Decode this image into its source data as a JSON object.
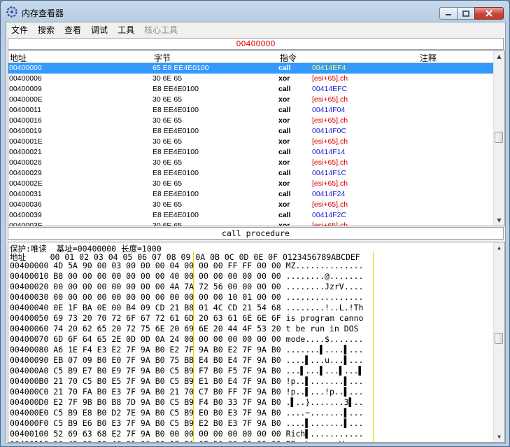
{
  "window": {
    "title": "内存查看器"
  },
  "menu": [
    "文件",
    "搜索",
    "查看",
    "调试",
    "工具",
    "核心工具"
  ],
  "address_bar": "00400000",
  "disasm": {
    "headers": {
      "address": "地址",
      "bytes": "字节",
      "opcode": "指令",
      "comment": "注释"
    },
    "rows": [
      {
        "addr": "00400000",
        "bytes": "65 E8 EE4E0100",
        "op": "call",
        "arg": "00414EF4",
        "kind": "call"
      },
      {
        "addr": "00400006",
        "bytes": "30 6E 65",
        "op": "xor",
        "arg1": "[esi+65]",
        "arg2": ",ch",
        "kind": "xor"
      },
      {
        "addr": "00400009",
        "bytes": "E8 EE4E0100",
        "op": "call",
        "arg": "00414EFC",
        "kind": "call"
      },
      {
        "addr": "0040000E",
        "bytes": "30 6E 65",
        "op": "xor",
        "arg1": "[esi+65]",
        "arg2": ",ch",
        "kind": "xor"
      },
      {
        "addr": "00400011",
        "bytes": "E8 EE4E0100",
        "op": "call",
        "arg": "00414F04",
        "kind": "call"
      },
      {
        "addr": "00400016",
        "bytes": "30 6E 65",
        "op": "xor",
        "arg1": "[esi+65]",
        "arg2": ",ch",
        "kind": "xor"
      },
      {
        "addr": "00400019",
        "bytes": "E8 EE4E0100",
        "op": "call",
        "arg": "00414F0C",
        "kind": "call"
      },
      {
        "addr": "0040001E",
        "bytes": "30 6E 65",
        "op": "xor",
        "arg1": "[esi+65]",
        "arg2": ",ch",
        "kind": "xor"
      },
      {
        "addr": "00400021",
        "bytes": "E8 EE4E0100",
        "op": "call",
        "arg": "00414F14",
        "kind": "call"
      },
      {
        "addr": "00400026",
        "bytes": "30 6E 65",
        "op": "xor",
        "arg1": "[esi+65]",
        "arg2": ",ch",
        "kind": "xor"
      },
      {
        "addr": "00400029",
        "bytes": "E8 EE4E0100",
        "op": "call",
        "arg": "00414F1C",
        "kind": "call"
      },
      {
        "addr": "0040002E",
        "bytes": "30 6E 65",
        "op": "xor",
        "arg1": "[esi+65]",
        "arg2": ",ch",
        "kind": "xor"
      },
      {
        "addr": "00400031",
        "bytes": "E8 EE4E0100",
        "op": "call",
        "arg": "00414F24",
        "kind": "call"
      },
      {
        "addr": "00400036",
        "bytes": "30 6E 65",
        "op": "xor",
        "arg1": "[esi+65]",
        "arg2": ",ch",
        "kind": "xor"
      },
      {
        "addr": "00400039",
        "bytes": "E8 EE4E0100",
        "op": "call",
        "arg": "00414F2C",
        "kind": "call"
      },
      {
        "addr": "0040003E",
        "bytes": "30 6E 65",
        "op": "xor",
        "arg1": "[esi+65]",
        "arg2": ",ch",
        "kind": "xor"
      }
    ]
  },
  "status_line": "call procedure",
  "hex": {
    "info": "保护:唯读  基址=00400000 长度=1000",
    "header": "地址     00 01 02 03 04 05 06 07 08 09 0A 0B 0C 0D 0E 0F 0123456789ABCDEF",
    "rows": [
      "00400000 4D 5A 90 00 03 00 00 00 04 00 00 00 FF FF 00 00 MZ..............",
      "00400010 B8 00 00 00 00 00 00 00 40 00 00 00 00 00 00 00 ........@.......",
      "00400020 00 00 00 00 00 00 00 00 4A 7A 72 56 00 00 00 00 ........JzrV....",
      "00400030 00 00 00 00 00 00 00 00 00 00 00 00 10 01 00 00 ................",
      "00400040 0E 1F BA 0E 00 B4 09 CD 21 B8 01 4C CD 21 54 68 ........!..L.!Th",
      "00400050 69 73 20 70 72 6F 67 72 61 6D 20 63 61 6E 6E 6F is program canno",
      "00400060 74 20 62 65 20 72 75 6E 20 69 6E 20 44 4F 53 20 t be run in DOS ",
      "00400070 6D 6F 64 65 2E 0D 0D 0A 24 00 00 00 00 00 00 00 mode....$.......",
      "00400080 A6 1E F4 E3 E2 7F 9A B0 E2 7F 9A B0 E2 7F 9A B0 .......▌....▌...",
      "00400090 EB 07 09 B0 E0 7F 9A B0 75 BB E4 B0 E4 7F 9A B0 ....▌...u...▌...",
      "004000A0 C5 B9 E7 B0 E9 7F 9A B0 C5 B9 F7 B0 F5 7F 9A B0 ...▌...▌...▌...▌",
      "004000B0 21 70 C5 B0 E5 7F 9A B0 C5 B9 E1 B0 E4 7F 9A B0 !p..▌.......▌...",
      "004000C0 21 70 FA B0 E3 7F 9A B0 21 70 C7 B0 FF 7F 9A B0 !p..▌...!p..▌...",
      "004000D0 E2 7F 9B B0 B8 7D 9A B0 C5 B9 F4 B0 33 7F 9A B0 .▌..}.......3▌..",
      "004000E0 C5 B9 E8 B0 D2 7E 9A B0 C5 B9 E0 B0 E3 7F 9A B0 ....~.......▌...",
      "004000F0 C5 B9 E6 B0 E3 7F 9A B0 C5 B9 E2 B0 E3 7F 9A B0 ....▌.......▌...",
      "00400100 52 69 63 68 E2 7F 9A B0 00 00 00 00 00 00 00 00 Rich▌...........",
      "00400110 50 45 00 00 4C 01 06 00 1F EA 6F 56 00 00 00 00 PE..L.....oV....",
      "00400120 00 00 00 00 E0 00 23 01 0B 01 08 00 00 A0 2A 00 ......#.......*."
    ]
  }
}
